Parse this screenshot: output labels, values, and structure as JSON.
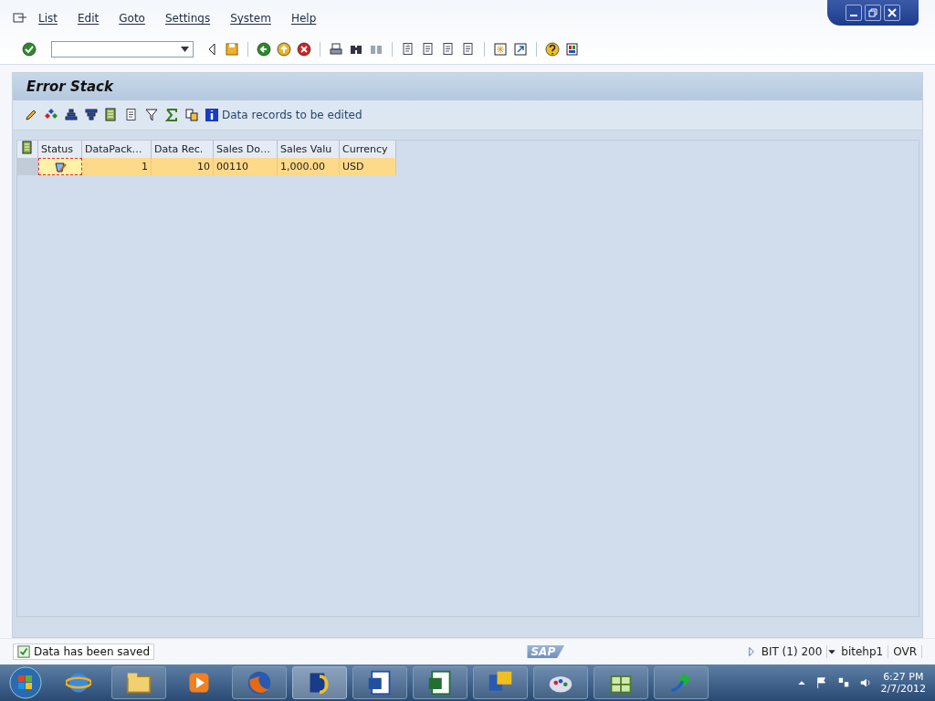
{
  "menu": [
    {
      "label": "List"
    },
    {
      "label": "Edit"
    },
    {
      "label": "Goto"
    },
    {
      "label": "Settings"
    },
    {
      "label": "System"
    },
    {
      "label": "Help"
    }
  ],
  "screen": {
    "title": "Error Stack",
    "toolbar_text": "Data records to be edited"
  },
  "table": {
    "columns": [
      "Status",
      "DataPack…",
      "Data Rec.",
      "Sales Do…",
      "Sales Valu",
      "Currency"
    ],
    "rows": [
      {
        "selected": true,
        "values": [
          "1",
          "10",
          "00110",
          "1,000.00",
          "USD"
        ]
      }
    ]
  },
  "status_bar": {
    "message": "Data has been saved",
    "logo": "SAP",
    "system": "BIT (1) 200",
    "server": "bitehp1",
    "mode": "OVR"
  },
  "taskbar": {
    "time": "6:27 PM",
    "date": "2/7/2012"
  }
}
